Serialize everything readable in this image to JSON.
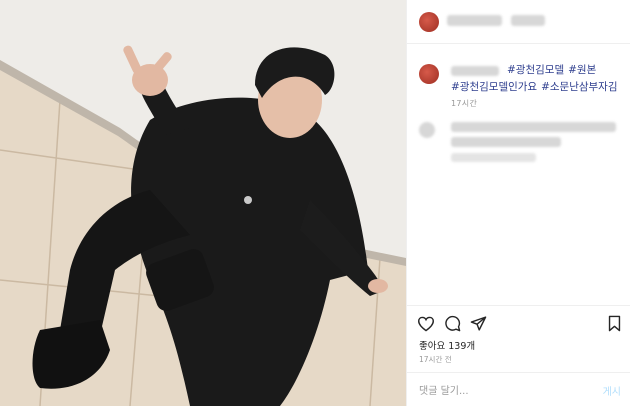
{
  "caption": {
    "hashtags": [
      "#광천김모델",
      "#원본",
      "#광천김모델인가요",
      "#소문난삼부자김"
    ]
  },
  "caption_time": "17시간",
  "likes": {
    "label": "좋아요",
    "count": "139개"
  },
  "posted_time": "17시간 전",
  "comment": {
    "placeholder": "댓글 달기...",
    "post_label": "게시"
  },
  "icons": [
    "heart-icon",
    "comment-icon",
    "share-icon",
    "bookmark-icon"
  ],
  "colors": {
    "hashtag": "#2e3e8e",
    "post_button": "#b2dffc"
  }
}
